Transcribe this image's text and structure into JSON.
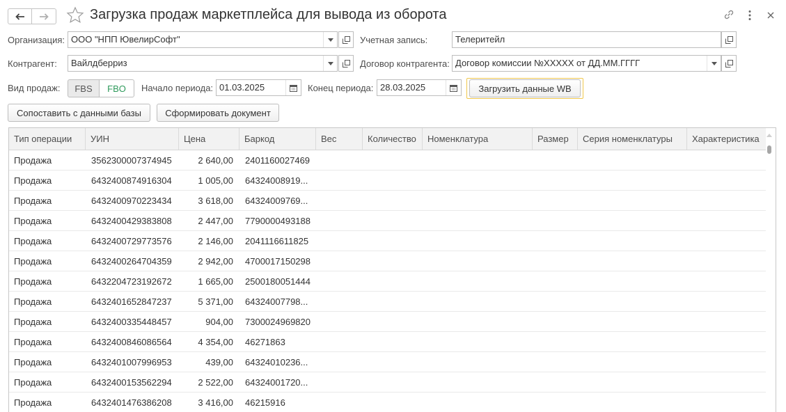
{
  "window": {
    "title": "Загрузка продаж маркетплейса для вывода из оборота"
  },
  "form": {
    "organization_label": "Организация:",
    "organization_value": "ООО \"НПП ЮвелирСофт\"",
    "account_label": "Учетная запись:",
    "account_value": "Телеритейл",
    "counterparty_label": "Контрагент:",
    "counterparty_value": "Вайлдберриз",
    "contract_label": "Договор контрагента:",
    "contract_value": "Договор комиссии №ХХХХХ от ДД.ММ.ГГГГ",
    "sales_type_label": "Вид продаж:",
    "sales_type_options": [
      "FBS",
      "FBO"
    ],
    "sales_type_selected": "FBO",
    "period_start_label": "Начало периода:",
    "period_start_value": "01.03.2025",
    "period_end_label": "Конец периода:",
    "period_end_value": "28.03.2025",
    "load_button": "Загрузить данные WB",
    "compare_button": "Сопоставить с данными базы",
    "create_doc_button": "Сформировать документ"
  },
  "table": {
    "columns": [
      "Тип операции",
      "УИН",
      "Цена",
      "Баркод",
      "Вес",
      "Количество",
      "Номенклатура",
      "Размер",
      "Серия номенклатуры",
      "Характеристика"
    ],
    "rows": [
      [
        "Продажа",
        "3562300007374945",
        "2 640,00",
        "2401160027469"
      ],
      [
        "Продажа",
        "6432400874916304",
        "1 005,00",
        "64324008919..."
      ],
      [
        "Продажа",
        "6432400970223434",
        "3 618,00",
        "64324009769..."
      ],
      [
        "Продажа",
        "6432400429383808",
        "2 447,00",
        "7790000493188"
      ],
      [
        "Продажа",
        "6432400729773576",
        "2 146,00",
        "2041116611825"
      ],
      [
        "Продажа",
        "6432400264704359",
        "2 942,00",
        "4700017150298"
      ],
      [
        "Продажа",
        "6432204723192672",
        "1 665,00",
        "2500180051444"
      ],
      [
        "Продажа",
        "6432401652847237",
        "5 371,00",
        "64324007798..."
      ],
      [
        "Продажа",
        "6432400335448457",
        "904,00",
        "7300024969820"
      ],
      [
        "Продажа",
        "6432400846086564",
        "4 354,00",
        "46271863"
      ],
      [
        "Продажа",
        "6432401007996953",
        "439,00",
        "64324010236..."
      ],
      [
        "Продажа",
        "6432400153562294",
        "2 522,00",
        "64324001720..."
      ],
      [
        "Продажа",
        "6432401476386208",
        "3 416,00",
        "46215916"
      ]
    ]
  },
  "colors": {
    "fbo_selected_text": "#2e9a5b",
    "load_button_border": "#f0c74c"
  }
}
